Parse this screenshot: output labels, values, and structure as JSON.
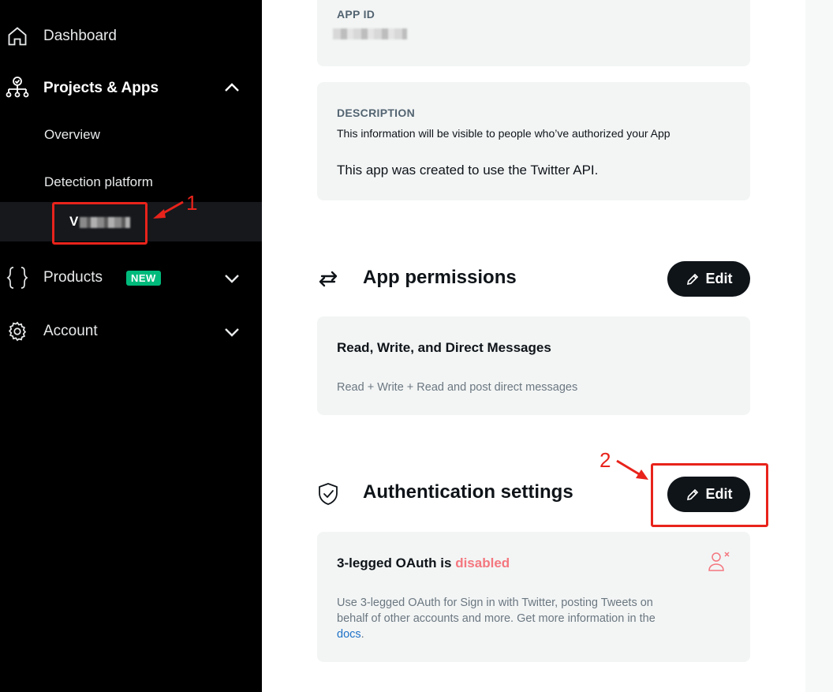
{
  "sidebar": {
    "dashboard_label": "Dashboard",
    "projects_label": "Projects & Apps",
    "overview_label": "Overview",
    "detection_label": "Detection platform",
    "active_app_prefix": "V",
    "products_label": "Products",
    "products_badge": "NEW",
    "account_label": "Account"
  },
  "annotations": {
    "marker1": "1",
    "marker2": "2",
    "color": "#e8231b"
  },
  "app_id": {
    "caption": "APP ID"
  },
  "description": {
    "caption": "DESCRIPTION",
    "helper": "This information will be visible to people who’ve authorized your App",
    "text": "This app was created to use the Twitter API."
  },
  "permissions": {
    "title": "App permissions",
    "edit_label": "Edit",
    "level": "Read, Write, and Direct Messages",
    "detail": "Read + Write + Read and post direct messages"
  },
  "authentication": {
    "title": "Authentication settings",
    "edit_label": "Edit",
    "status_prefix": "3-legged OAuth is",
    "status_value": "disabled",
    "info_line1": "Use 3-legged OAuth for Sign in with Twitter, posting Tweets on",
    "info_line2": "behalf of other accounts and more. Get more information in the",
    "docs_link": "docs",
    "docs_suffix": "."
  },
  "colors": {
    "sidebar_bg": "#000000",
    "new_badge": "#00ba7c",
    "disabled_text": "#f4777f",
    "link": "#1d71c7",
    "button_bg": "#0f1419"
  },
  "icons": [
    "home-icon",
    "sitemap-icon",
    "chevron-up-icon",
    "braces-icon",
    "chevron-down-icon",
    "gear-icon",
    "swap-arrows-icon",
    "shield-check-icon",
    "pencil-icon",
    "user-x-icon"
  ]
}
